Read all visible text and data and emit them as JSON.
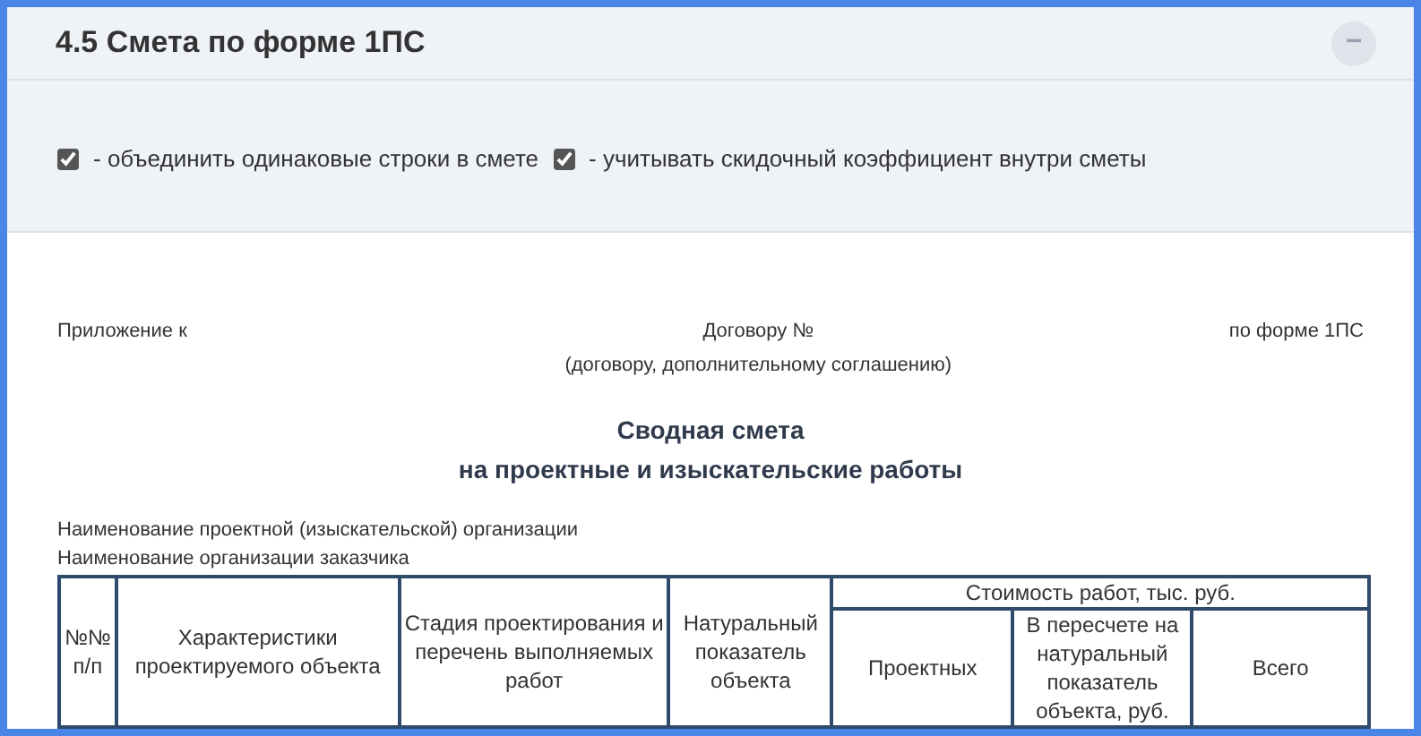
{
  "panel": {
    "title": "4.5 Смета по форме 1ПС",
    "collapse_button": "−"
  },
  "options": [
    {
      "label": "- объединить одинаковые строки в смете",
      "checked": true
    },
    {
      "label": "- учитывать скидочный коэффициент внутри сметы",
      "checked": true
    }
  ],
  "document": {
    "annex_left": "Приложение к",
    "annex_center": "Договору №",
    "annex_center_note": "(договору, дополнительному соглашению)",
    "annex_right": "по форме 1ПС",
    "title_lines": [
      "Сводная смета",
      "на проектные и изыскательские работы"
    ],
    "org_lines": [
      "Наименование проектной (изыскательской) организации",
      "Наименование организации заказчика"
    ],
    "table": {
      "columns": [
        "№№ п/п",
        "Характеристики проектируемого объекта",
        "Стадия проектирования и перечень выполняемых работ",
        "Натуральный показатель объекта"
      ],
      "group_header": "Стоимость работ, тыс. руб.",
      "sub_columns": [
        "Проектных",
        "В пересчете на натуральный показатель объекта, руб.",
        "Всего"
      ]
    }
  }
}
